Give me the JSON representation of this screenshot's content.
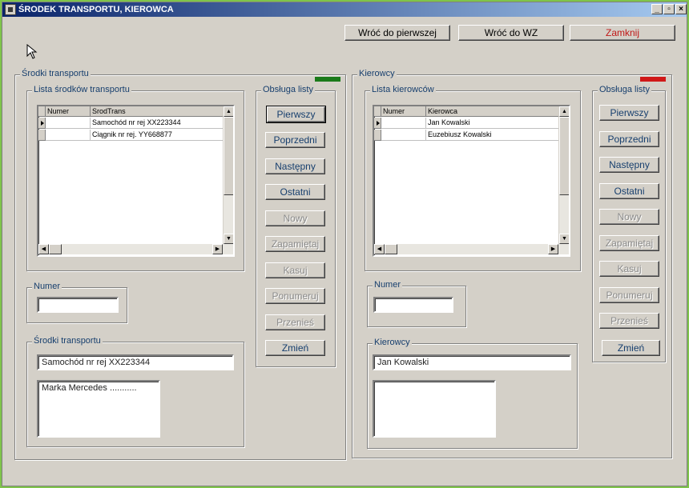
{
  "window": {
    "title": "ŚRODEK TRANSPORTU, KIEROWCA",
    "min": "_",
    "max": "▫",
    "close": "×"
  },
  "toolbar": {
    "first": "Wróć do pierwszej",
    "back_wz": "Wróć do WZ",
    "close": "Zamknij"
  },
  "colors": {
    "left_indicator": "#1a7a1a",
    "right_indicator": "#d01818",
    "close_label": "#c01818"
  },
  "left": {
    "title": "Środki transportu",
    "list_title": "Lista środków transportu",
    "columns": [
      "Numer",
      "SrodTrans"
    ],
    "rows": [
      {
        "numer": "",
        "value": "Samochód nr rej XX223344"
      },
      {
        "numer": "",
        "value": "Ciągnik nr rej. YY668877"
      }
    ],
    "ops_title": "Obsługa listy",
    "buttons": [
      "Pierwszy",
      "Poprzedni",
      "Następny",
      "Ostatni",
      "Nowy",
      "Zapamiętaj",
      "Kasuj",
      "Ponumeruj",
      "Przenieś",
      "Zmień"
    ],
    "numer_title": "Numer",
    "numer_value": "",
    "detail_title": "Środki transportu",
    "detail_value": "Samochód nr rej XX223344",
    "memo_value": "Marka Mercedes ..........."
  },
  "right": {
    "title": "Kierowcy",
    "list_title": "Lista kierowców",
    "columns": [
      "Numer",
      "Kierowca"
    ],
    "rows": [
      {
        "numer": "",
        "value": "Jan Kowalski"
      },
      {
        "numer": "",
        "value": "Euzebiusz Kowalski"
      }
    ],
    "ops_title": "Obsługa listy",
    "buttons": [
      "Pierwszy",
      "Poprzedni",
      "Następny",
      "Ostatni",
      "Nowy",
      "Zapamiętaj",
      "Kasuj",
      "Ponumeruj",
      "Przenieś",
      "Zmień"
    ],
    "numer_title": "Numer",
    "numer_value": "",
    "detail_title": "Kierowcy",
    "detail_value": "Jan Kowalski",
    "memo_value": ""
  },
  "scroll": {
    "up": "▲",
    "down": "▼",
    "left": "◀",
    "right": "▶"
  }
}
